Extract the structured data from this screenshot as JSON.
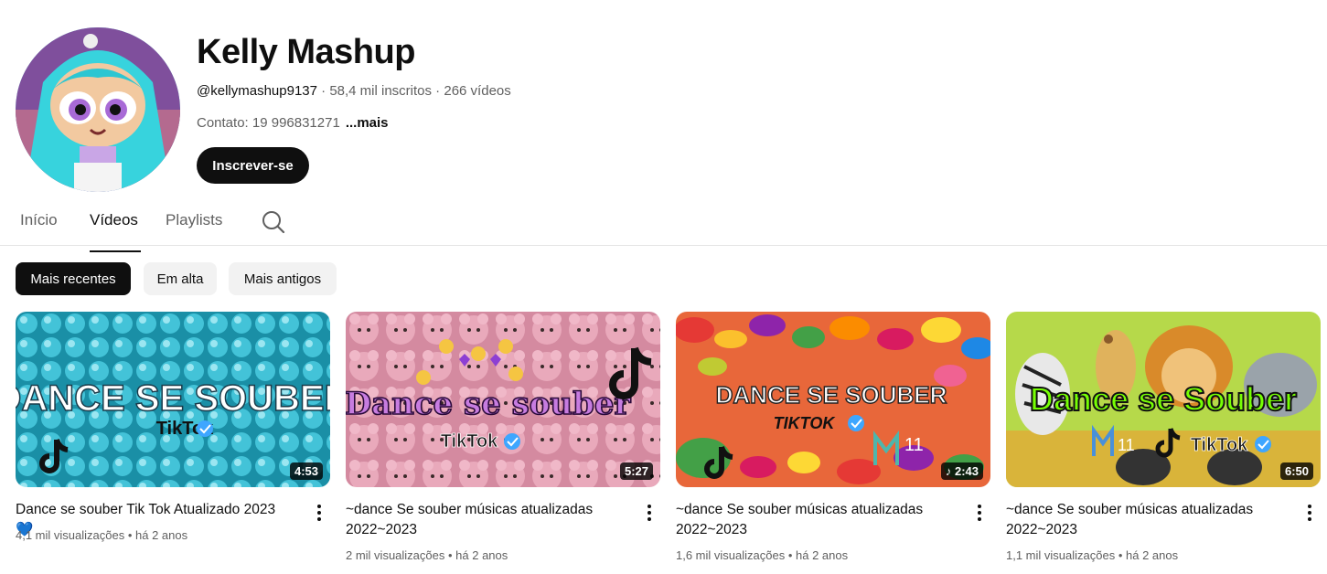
{
  "channel": {
    "name": "Kelly Mashup",
    "handle": "@kellymashup9137",
    "subscribers": "58,4 mil inscritos",
    "videos_count": "266 vídeos",
    "separator": " · ",
    "contact": "Contato: 19 996831271",
    "more_label": "...mais",
    "subscribe_label": "Inscrever-se"
  },
  "tabs": [
    {
      "label": "Início"
    },
    {
      "label": "Vídeos"
    },
    {
      "label": "Playlists"
    }
  ],
  "chips": [
    {
      "label": "Mais recentes"
    },
    {
      "label": "Em alta"
    },
    {
      "label": "Mais antigos"
    }
  ],
  "videos": [
    {
      "title": "Dance se souber Tik Tok Atualizado 2023",
      "title_emoji": "💙",
      "views": "4,1 mil visualizações",
      "age": "há 2 anos",
      "duration": "4:53",
      "thumb_text": "DANCE SE SOUBER",
      "thumb_sub": "TikTok"
    },
    {
      "title": "~dance Se souber músicas atualizadas 2022~2023",
      "views": "2 mil visualizações",
      "age": "há 2 anos",
      "duration": "5:27",
      "thumb_text": "Dance se souber",
      "thumb_sub": "TikTok"
    },
    {
      "title": "~dance Se souber músicas atualizadas 2022~2023",
      "views": "1,6 mil visualizações",
      "age": "há 2 anos",
      "duration": "♪ 2:43",
      "thumb_text": "DANCE SE SOUBER",
      "thumb_sub": "TIKTOK",
      "thumb_extra": "11"
    },
    {
      "title": "~dance Se souber músicas atualizadas 2022~2023",
      "views": "1,1 mil visualizações",
      "age": "há 2 anos",
      "duration": "6:50",
      "thumb_text": "Dance se Souber",
      "thumb_sub": "TikTok",
      "thumb_extra": "11"
    }
  ],
  "meta_sep": " • ",
  "colors": {
    "accent": "#0f0f0f",
    "secondary_text": "#606060",
    "chip_bg": "#f2f2f2",
    "verified_blue": "#3ea6ff"
  },
  "icons": [
    "search-icon",
    "more-vert-icon",
    "tiktok-icon",
    "verified-icon"
  ]
}
